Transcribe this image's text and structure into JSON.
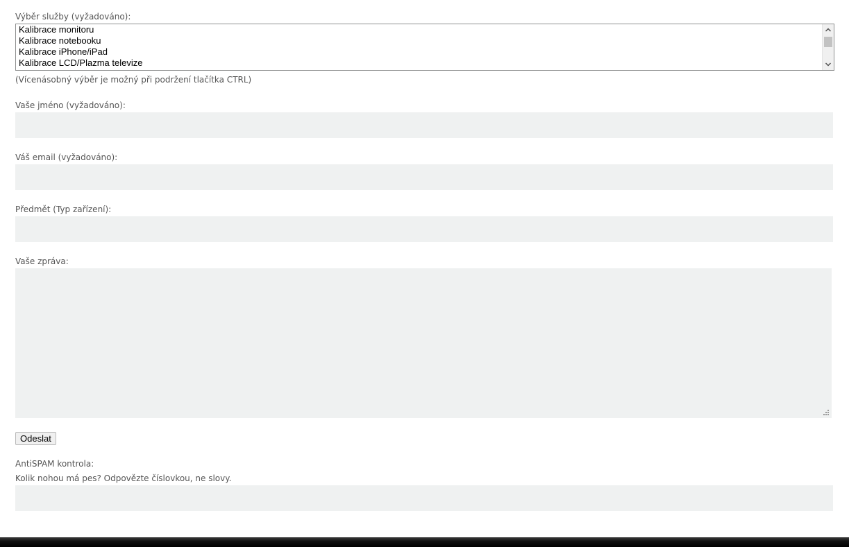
{
  "service": {
    "label": "Výběr služby (vyžadováno):",
    "options": [
      "Kalibrace monitoru",
      "Kalibrace notebooku",
      "Kalibrace iPhone/iPad",
      "Kalibrace LCD/Plazma televize"
    ],
    "hint": "(Vícenásobný výběr je možný při podržení tlačítka CTRL)",
    "scroll_up_icon": "chevron-up-icon",
    "scroll_down_icon": "chevron-down-icon"
  },
  "name": {
    "label": "Vaše jméno (vyžadováno):",
    "value": ""
  },
  "email": {
    "label": "Váš email (vyžadováno):",
    "value": ""
  },
  "subject": {
    "label": "Předmět (Typ zařízení):",
    "value": ""
  },
  "message": {
    "label": "Vaše zpráva:",
    "value": "",
    "resize_icon": "resize-grip-icon"
  },
  "submit": {
    "label": "Odeslat"
  },
  "antispam": {
    "label": "AntiSPAM kontrola:",
    "question": "Kolik nohou má pes? Odpovězte číslovkou, ne slovy.",
    "value": ""
  },
  "colors": {
    "input_bg": "#eff1f1",
    "label_text": "#555555",
    "footer": "#000000"
  }
}
